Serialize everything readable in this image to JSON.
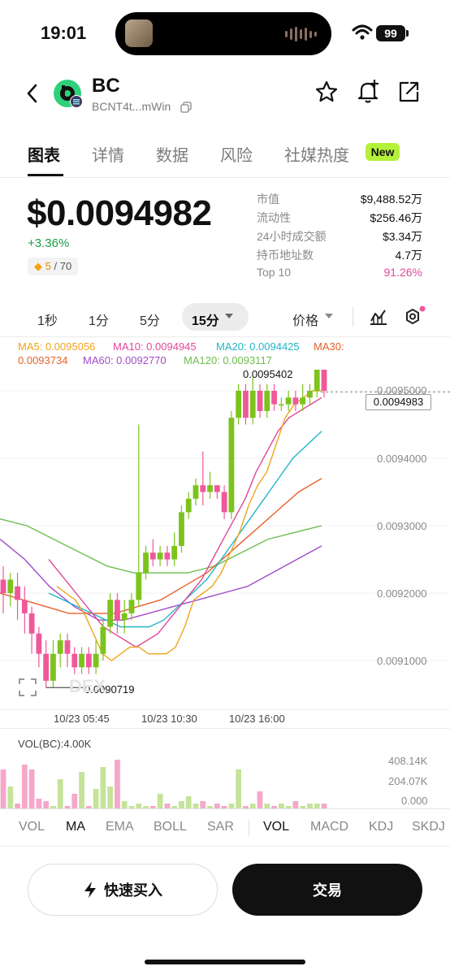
{
  "status_bar": {
    "time": "19:01",
    "battery": "99"
  },
  "header": {
    "name": "BC",
    "address": "BCNT4t...mWin"
  },
  "tabs": [
    {
      "label": "图表"
    },
    {
      "label": "详情"
    },
    {
      "label": "数据"
    },
    {
      "label": "风险"
    },
    {
      "label": "社媒热度"
    }
  ],
  "new_badge": "New",
  "price": {
    "value": "$0.0094982",
    "change": "+3.36%",
    "score": "5",
    "score_total": "/ 70"
  },
  "stats": [
    {
      "label": "市值",
      "value": "$9,488.52万"
    },
    {
      "label": "流动性",
      "value": "$256.46万"
    },
    {
      "label": "24小时成交额",
      "value": "$3.34万"
    },
    {
      "label": "持币地址数",
      "value": "4.7万"
    },
    {
      "label": "Top 10",
      "value": "91.26%"
    }
  ],
  "colors": {
    "up": "#7cc31c",
    "down": "#f0589a",
    "accent_green": "#1a9d45",
    "top10": "#e0499a"
  },
  "intervals": [
    {
      "label": "1秒"
    },
    {
      "label": "1分"
    },
    {
      "label": "5分"
    },
    {
      "label": "15分"
    }
  ],
  "price_toggle": "价格",
  "ma": {
    "ma5": "MA5: 0.0095056",
    "ma10": "MA10: 0.0094945",
    "ma20": "MA20: 0.0094425",
    "ma30_a": "MA30:",
    "ma30_b": "0.0093734",
    "ma60": "MA60: 0.0092770",
    "ma120": "MA120: 0.0093117"
  },
  "chart_data": {
    "type": "candlestick",
    "y_ticks": [
      "0.0095000",
      "0.0094000",
      "0.0093000",
      "0.0092000",
      "0.0091000"
    ],
    "x_ticks": [
      "10/23 05:45",
      "10/23 10:30",
      "10/23 16:00"
    ],
    "high_label": "0.0095402",
    "low_label": "0.0090719",
    "current_label": "0.0094983",
    "candles": [
      [
        0.00922,
        0.0092,
        0.00924,
        0.00917
      ],
      [
        0.0092,
        0.00922,
        0.00923,
        0.00918
      ],
      [
        0.00921,
        0.00919,
        0.00923,
        0.00916
      ],
      [
        0.00919,
        0.00917,
        0.00921,
        0.00914
      ],
      [
        0.00917,
        0.00914,
        0.00918,
        0.00911
      ],
      [
        0.00914,
        0.00911,
        0.00915,
        0.00909
      ],
      [
        0.00911,
        0.00907,
        0.00913,
        0.00906
      ],
      [
        0.00907,
        0.00911,
        0.00913,
        0.00906
      ],
      [
        0.00911,
        0.00913,
        0.00914,
        0.00909
      ],
      [
        0.00913,
        0.00911,
        0.00914,
        0.00909
      ],
      [
        0.00911,
        0.00909,
        0.00912,
        0.00908
      ],
      [
        0.00909,
        0.00911,
        0.00912,
        0.00908
      ],
      [
        0.00911,
        0.00909,
        0.00912,
        0.00908
      ],
      [
        0.00909,
        0.00911,
        0.00913,
        0.00908
      ],
      [
        0.00911,
        0.00915,
        0.00916,
        0.0091
      ],
      [
        0.00915,
        0.00919,
        0.0092,
        0.00914
      ],
      [
        0.00919,
        0.00916,
        0.0092,
        0.00914
      ],
      [
        0.00916,
        0.00917,
        0.00919,
        0.00914
      ],
      [
        0.00917,
        0.00919,
        0.0092,
        0.00916
      ],
      [
        0.00919,
        0.00923,
        0.00945,
        0.00918
      ],
      [
        0.00923,
        0.00926,
        0.00927,
        0.00922
      ],
      [
        0.00926,
        0.00925,
        0.00928,
        0.00924
      ],
      [
        0.00925,
        0.00926,
        0.00927,
        0.00924
      ],
      [
        0.00926,
        0.00925,
        0.00927,
        0.00924
      ],
      [
        0.00925,
        0.00927,
        0.00929,
        0.00924
      ],
      [
        0.00927,
        0.00932,
        0.00933,
        0.00926
      ],
      [
        0.00932,
        0.00934,
        0.00935,
        0.00931
      ],
      [
        0.00934,
        0.00936,
        0.00937,
        0.00933
      ],
      [
        0.00936,
        0.00935,
        0.00941,
        0.00933
      ],
      [
        0.00935,
        0.00936,
        0.00938,
        0.00934
      ],
      [
        0.00936,
        0.00935,
        0.00936,
        0.00934
      ],
      [
        0.00935,
        0.00932,
        0.00936,
        0.00931
      ],
      [
        0.00932,
        0.00946,
        0.00947,
        0.00931
      ],
      [
        0.00946,
        0.0095,
        0.00951,
        0.00945
      ],
      [
        0.0095,
        0.00946,
        0.00951,
        0.00945
      ],
      [
        0.00946,
        0.0095,
        0.00952,
        0.00945
      ],
      [
        0.0095,
        0.00947,
        0.00951,
        0.00946
      ],
      [
        0.00947,
        0.0095,
        0.00951,
        0.00946
      ],
      [
        0.0095,
        0.00948,
        0.00951,
        0.00947
      ],
      [
        0.00948,
        0.00948,
        0.00949,
        0.00947
      ],
      [
        0.00948,
        0.00949,
        0.0095,
        0.00947
      ],
      [
        0.00949,
        0.00948,
        0.0095,
        0.00947
      ],
      [
        0.00948,
        0.00949,
        0.00951,
        0.00947
      ],
      [
        0.00949,
        0.0095,
        0.00951,
        0.00948
      ],
      [
        0.0095,
        0.00954,
        0.00954,
        0.00949
      ],
      [
        0.00954,
        0.0095,
        0.00954,
        0.00949
      ]
    ],
    "ma_series": {
      "ma5": [
        0.00921,
        0.0092,
        0.00919,
        0.00917,
        0.00914,
        0.00911,
        0.0091,
        0.00911,
        0.00912,
        0.00912,
        0.00911,
        0.00911,
        0.00911,
        0.00912,
        0.00915,
        0.00919,
        0.0092,
        0.00921,
        0.00923,
        0.00926,
        0.00929,
        0.00933,
        0.00936,
        0.00938,
        0.00942,
        0.00946,
        0.00948,
        0.00949,
        0.0095,
        0.0095
      ],
      "ma10": [
        0.00925,
        0.00923,
        0.00921,
        0.00919,
        0.00917,
        0.00915,
        0.00914,
        0.00913,
        0.00912,
        0.00913,
        0.00914,
        0.00916,
        0.00918,
        0.0092,
        0.00922,
        0.00925,
        0.00928,
        0.00931,
        0.00934,
        0.00938,
        0.00941,
        0.00944,
        0.00946,
        0.00947,
        0.00948,
        0.00949
      ],
      "ma20": [
        0.0092,
        0.00919,
        0.00918,
        0.00917,
        0.00916,
        0.00915,
        0.00915,
        0.00915,
        0.00916,
        0.00918,
        0.0092,
        0.00922,
        0.00925,
        0.00928,
        0.00931,
        0.00934,
        0.00937,
        0.0094,
        0.00942,
        0.00944
      ],
      "ma30": [
        0.0092,
        0.00919,
        0.00918,
        0.00917,
        0.00917,
        0.00917,
        0.00918,
        0.00919,
        0.00921,
        0.00923,
        0.00926,
        0.00929,
        0.00932,
        0.00935,
        0.00937
      ],
      "ma60": [
        0.00928,
        0.00925,
        0.00921,
        0.00918,
        0.00916,
        0.00916,
        0.00917,
        0.00918,
        0.00919,
        0.0092,
        0.00921,
        0.00923,
        0.00925,
        0.00927
      ],
      "ma120": [
        0.00931,
        0.0093,
        0.00928,
        0.00926,
        0.00924,
        0.00923,
        0.00923,
        0.00923,
        0.00924,
        0.00926,
        0.00928,
        0.00929,
        0.0093
      ]
    },
    "volume_label": "VOL(BC):4.00K",
    "volume_ticks": [
      "408.14K",
      "204.07K",
      "0.000"
    ],
    "volumes": [
      160,
      90,
      20,
      180,
      160,
      40,
      30,
      10,
      120,
      10,
      60,
      150,
      10,
      80,
      170,
      90,
      200,
      30,
      10,
      20,
      10,
      10,
      60,
      20,
      10,
      30,
      50,
      20,
      30,
      10,
      20,
      10,
      20,
      160,
      10,
      20,
      70,
      20,
      10,
      20,
      10,
      30,
      10,
      20,
      20,
      20
    ]
  },
  "indicators": [
    {
      "label": "VOL"
    },
    {
      "label": "MA"
    },
    {
      "label": "EMA"
    },
    {
      "label": "BOLL"
    },
    {
      "label": "SAR"
    },
    {
      "label": "VOL"
    },
    {
      "label": "MACD"
    },
    {
      "label": "KDJ"
    },
    {
      "label": "SKDJ"
    }
  ],
  "buttons": {
    "quick_buy": "快速买入",
    "trade": "交易"
  }
}
